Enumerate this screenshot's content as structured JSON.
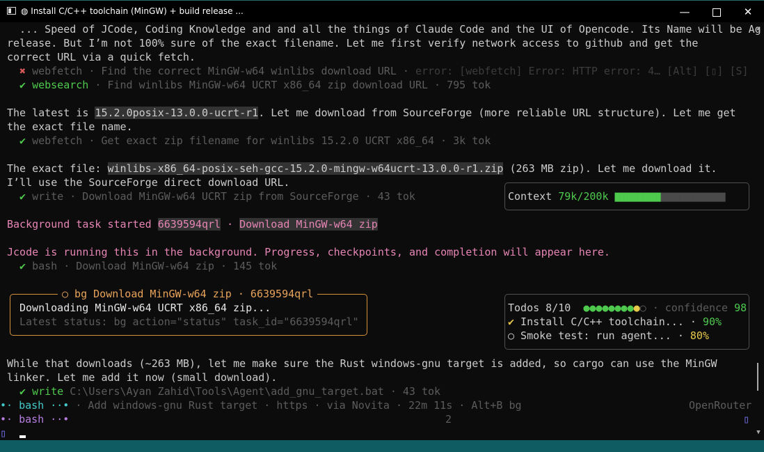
{
  "window": {
    "title": "◍ Install C/C++ toolchain (MinGW) + build release ...",
    "minimize": "—",
    "close": "✕"
  },
  "msg1": {
    "l1": "  ... Speed of JCode, Coding Knowledge and and all the things of Claude Code and the UI of Opencode. Its Name will be Ag",
    "l2": "release. But I’m not 100% sure of the exact filename. Let me first verify network access to github and get the",
    "l3": "correct URL via a quick fetch."
  },
  "tool_webfetch1": {
    "icon": "✖",
    "name": "webfetch",
    "text": " · Find the correct MinGW-w64 winlibs download URL · ",
    "error": "error: [webfetch] Error: HTTP error: 4… [Alt] [▯] [S]"
  },
  "tool_websearch": {
    "icon": "✔",
    "name": "websearch",
    "text": " · Find winlibs MinGW-w64 UCRT x86_64 zip download URL · 795 tok"
  },
  "msg2": {
    "pre": "The latest is ",
    "version": "15.2.0posix-13.0.0-ucrt-r1",
    "post": ". Let me download from SourceForge (more reliable URL structure). Let me get",
    "l2": "the exact file name."
  },
  "tool_webfetch2": {
    "icon": "✔",
    "text": "webfetch · Get exact zip filename for winlibs 15.2.0 UCRT x86_64 · 3k tok"
  },
  "msg3": {
    "pre": "The exact file: ",
    "file": "winlibs-x86_64-posix-seh-gcc-15.2.0-mingw-w64ucrt-13.0.0-r1.zip",
    "post": " (263 MB zip). Let me download it.",
    "l2": "I’ll use the SourceForge direct download URL."
  },
  "tool_write1": {
    "icon": "✔",
    "text": "write · Download MinGW-w64 UCRT zip from SourceForge · 43 tok"
  },
  "context": {
    "label": "Context ",
    "value": "79k/200k ",
    "bar_filled": "██████████",
    "bar_empty": "██████████████",
    "used_fraction": 0.395
  },
  "bgtask": {
    "pre": "Background task started ",
    "id": "6639594qrl",
    "sep": " · ",
    "name": "Download MinGW-w64 zip"
  },
  "jcode_msg": "Jcode is running this in the background. Progress, checkpoints, and completion will appear here.",
  "tool_bash": {
    "icon": "✔",
    "text": "bash · Download MinGW-w64 zip · 145 tok"
  },
  "bgbox": {
    "title": "○ bg Download MinGW-w64 zip · 6639594qrl",
    "line1": "Downloading MinGW-w64 UCRT x86_64 zip...",
    "line2": "Latest status: bg action=\"status\" task_id=\"6639594qrl\""
  },
  "todos": {
    "label": "Todos 8/10  ",
    "dots_done": "●●●●●●●●",
    "dot_active": "●",
    "dot_pending": "○",
    "conf_label": " · confidence ",
    "conf_value": "98",
    "item1_icon": "✔",
    "item1": " Install C/C++ toolchain... · ",
    "item1_pct": "90%",
    "item2_icon": "○",
    "item2": " Smoke test: run agent... · ",
    "item2_pct": "80%"
  },
  "msg4": {
    "l1": "While that downloads (~263 MB), let me make sure the Rust windows-gnu target is added, so cargo can use the MinGW",
    "l2": "linker. Let me add it now (small download)."
  },
  "tool_write2": {
    "icon": "✔",
    "name": "write",
    "path": " C:\\Users\\Ayan Zahid\\Tools\\Agent\\add_gnu_target.bat",
    "tok": " · 43 tok"
  },
  "status1": {
    "prefix": "•· bash ··•",
    "info": " · Add windows-gnu Rust target · https · via Novita · 22m 11s · Alt+B bg",
    "right": "OpenRouter"
  },
  "status2": {
    "prefix": "•· bash ··•",
    "num": "2",
    "icon": "▯"
  },
  "prompt_icon": "▯",
  "colors": {
    "accent_orange": "#d9913a",
    "green": "#4ec94e",
    "pink": "#e685b5",
    "teal": "#44c9c9",
    "taskbar": "#0f5d63"
  }
}
